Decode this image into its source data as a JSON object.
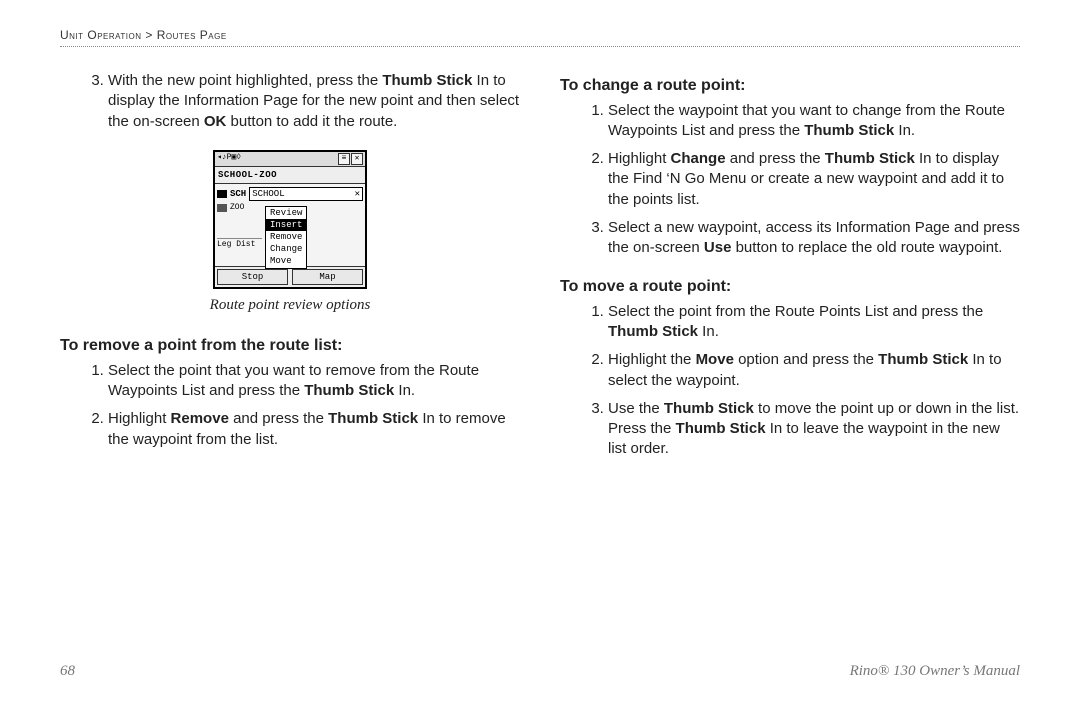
{
  "breadcrumb": "Unit Operation > Routes Page",
  "left": {
    "step3_pre": "With the new point highlighted, press the ",
    "step3_b1": "Thumb Stick",
    "step3_mid": " In to display the Information Page for the new point and then select the on-screen ",
    "step3_b2": "OK",
    "step3_post": " button to add it the route.",
    "caption": "Route point review options",
    "remove_heading": "To remove a point from the route list:",
    "remove_steps": {
      "s1_pre": "Select the point that you want to remove from the Route Waypoints List and press the ",
      "s1_b": "Thumb Stick",
      "s1_post": " In.",
      "s2_pre": "Highlight ",
      "s2_b1": "Remove",
      "s2_mid": " and press the ",
      "s2_b2": "Thumb Stick",
      "s2_post": " In to remove the waypoint from the list."
    }
  },
  "right": {
    "change_heading": "To change a route point:",
    "change_steps": {
      "s1_pre": "Select the waypoint that you want to change from the Route Waypoints List and press the ",
      "s1_b": "Thumb Stick",
      "s1_post": " In.",
      "s2_pre": "Highlight ",
      "s2_b1": "Change",
      "s2_mid": " and press the ",
      "s2_b2": "Thumb Stick",
      "s2_post": " In to display the Find ‘N Go Menu or create a new waypoint and add it to the points list.",
      "s3_pre": "Select a new waypoint, access its Information Page and press the on-screen ",
      "s3_b": "Use",
      "s3_post": " button to replace the old route waypoint."
    },
    "move_heading": "To move a route point:",
    "move_steps": {
      "s1_pre": "Select the point from the Route Points List and press the ",
      "s1_b": "Thumb Stick",
      "s1_post": " In.",
      "s2_pre": "Highlight the ",
      "s2_b1": "Move",
      "s2_mid": " option and press the ",
      "s2_b2": "Thumb Stick",
      "s2_post": " In to select the waypoint.",
      "s3_pre": "Use the ",
      "s3_b1": "Thumb Stick",
      "s3_mid": " to move the point up or down in the list. Press the ",
      "s3_b2": "Thumb Stick",
      "s3_post": " In to leave the waypoint in the new list order."
    }
  },
  "device": {
    "title": "SCHOOL-ZOO",
    "row_school": "SCHOOL",
    "row_zoo": "ZOO",
    "menu": [
      "Review",
      "Insert",
      "Remove",
      "Change",
      "Move"
    ],
    "menu_selected": "Insert",
    "legdist": "Leg Dist",
    "btn_left": "Stop",
    "btn_right": "Map",
    "top_icons": "◂♪P▣◊"
  },
  "footer": {
    "page_num": "68",
    "doc_title": "Rino® 130 Owner’s Manual"
  }
}
